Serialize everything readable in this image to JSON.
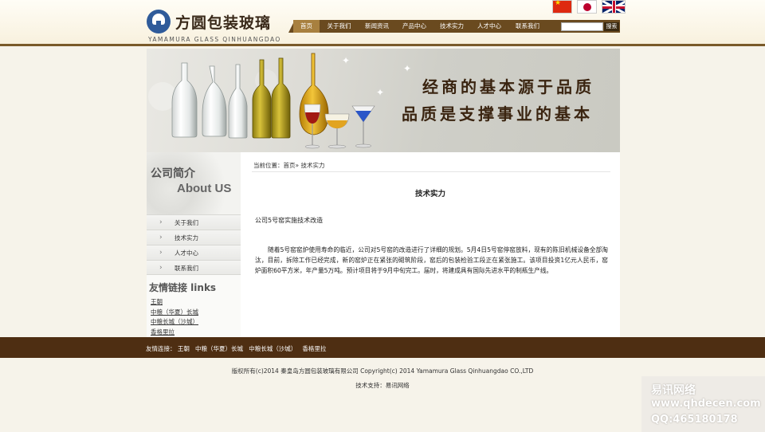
{
  "header": {
    "logo_cn": "方圆包装玻璃",
    "logo_en": "YAMAMURA GLASS QINHUANGDAO",
    "nav": [
      {
        "label": "首页",
        "active": true
      },
      {
        "label": "关于我们"
      },
      {
        "label": "新闻资讯"
      },
      {
        "label": "产品中心"
      },
      {
        "label": "技术实力"
      },
      {
        "label": "人才中心"
      },
      {
        "label": "联系我们"
      }
    ],
    "search_value": "",
    "search_button": "搜索",
    "flags": [
      "flag-china-icon",
      "flag-japan-icon",
      "flag-uk-icon"
    ]
  },
  "banner": {
    "line1": "经商的基本源于品质",
    "line2": "品质是支撑事业的基本"
  },
  "sidebar": {
    "about_cn": "公司简介",
    "about_en": "About US",
    "menu": [
      "关于我们",
      "技术实力",
      "人才中心",
      "联系我们"
    ],
    "links_title": "友情链接  links",
    "links": [
      "王朝",
      "中粮（华夏）长城",
      "中粮长城（沙城）",
      "香格里拉"
    ]
  },
  "main": {
    "breadcrumb_prefix": "当前位置：",
    "breadcrumb_home": "首页",
    "breadcrumb_sep": "»",
    "breadcrumb_current": " 技术实力",
    "title": "技术实力",
    "subtitle": "公司5号窑实施技术改造",
    "body": "随着5号窑窑炉使用寿命的临近，公司对5号窑的改造进行了详细的规划。5月4日5号窑停窑放料，现有的陈旧机械设备全部淘汰，目前，拆除工作已经完成，新的窑炉正在紧张的砌筑阶段，窑后的包装检验工段正在紧张施工。该项目投资1亿元人民币，窑炉面积60平方米，年产量5万吨。预计项目将于9月中旬完工。届时，将建成具有国际先进水平的制瓶生产线。"
  },
  "footer": {
    "links_label": "友情连接：",
    "links": [
      "王朝",
      "中粮（华夏）长城",
      "中粮长城（沙城）",
      "香格里拉"
    ],
    "copyright": "版权所有(c)2014 秦皇岛方圆包装玻璃有限公司  Copyright(c) 2014 Yamamura Glass Qinhuangdao CO.,LTD",
    "support_label": "技术支持：",
    "support_link": "易讯网络"
  },
  "watermark": {
    "line1": "易讯网络",
    "line2": "www.qhdecen.com",
    "line3": "QQ:465180178"
  },
  "colors": {
    "nav_bar": "#6a4a1f",
    "nav_active": "#a8803f",
    "footer_band": "#4e2e12",
    "page_bg": "#f6f3ea"
  }
}
